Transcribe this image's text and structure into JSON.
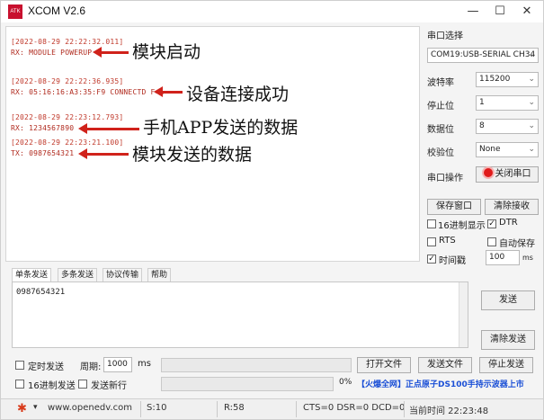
{
  "window": {
    "app_icon": "ATK",
    "title": "XCOM V2.6",
    "minimize": "—",
    "maximize": "☐",
    "close": "✕"
  },
  "receive": {
    "lines": [
      {
        "timestamp": "[2022-08-29 22:22:32.011]",
        "data": "RX: MODULE POWERUP"
      },
      {
        "timestamp": "[2022-08-29 22:22:36.935]",
        "data": "RX: 05:16:16:A3:35:F9 CONNECTD F=1"
      },
      {
        "timestamp": "[2022-08-29 22:23:12.793]",
        "data": "RX: 1234567890"
      },
      {
        "timestamp": "[2022-08-29 22:23:21.100]",
        "data": "TX: 0987654321"
      }
    ],
    "annotations": [
      "模块启动",
      "设备连接成功",
      "手机APP发送的数据",
      "模块发送的数据"
    ]
  },
  "serial": {
    "section_label": "串口选择",
    "port_value": "COM19:USB-SERIAL CH34",
    "baud_label": "波特率",
    "baud_value": "115200",
    "stopbits_label": "停止位",
    "stopbits_value": "1",
    "databits_label": "数据位",
    "databits_value": "8",
    "parity_label": "校验位",
    "parity_value": "None",
    "op_label": "串口操作",
    "close_port": "关闭串口",
    "save_window": "保存窗口",
    "clear_recv": "清除接收",
    "hex_display": "16进制显示",
    "dtr": "DTR",
    "rts": "RTS",
    "auto_save": "自动保存",
    "timestamp_label": "时间戳",
    "timestamp_value": "100",
    "ms": "ms"
  },
  "tabs": [
    "单条发送",
    "多条发送",
    "协议传输",
    "帮助"
  ],
  "send": {
    "text": "0987654321",
    "send_button": "发送",
    "clear_send": "清除发送",
    "timed_send": "定时发送",
    "period_label": "周期:",
    "period_value": "1000",
    "ms": "ms",
    "open_file": "打开文件",
    "send_file": "发送文件",
    "stop_send": "停止发送",
    "hex_send": "16进制发送",
    "send_newline": "发送新行",
    "progress_text": "0%",
    "promo": "【火爆全网】正点原子DS100手持示波器上市"
  },
  "status": {
    "url": "www.openedv.com",
    "s": "S:10",
    "r": "R:58",
    "lines": "CTS=0 DSR=0 DCD=0",
    "time": "当前时间 22:23:48"
  },
  "colors": {
    "accent_red": "#d0221b",
    "timestamp": "#c0392b",
    "led": "#e01b1b",
    "promo_blue": "#1a4fd6"
  },
  "icons": [
    "app-logo-icon",
    "minimize-icon",
    "maximize-icon",
    "close-icon",
    "dropdown-arrow-icon",
    "led-icon",
    "gear-icon",
    "checkbox-icon"
  ]
}
